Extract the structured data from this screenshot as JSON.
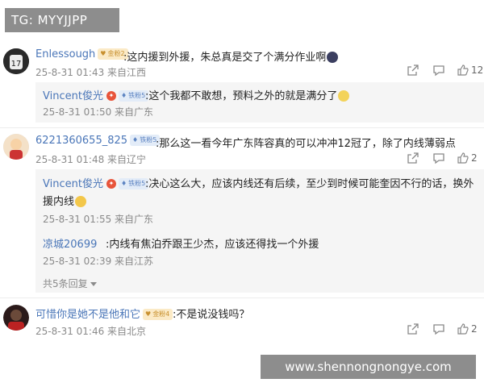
{
  "watermark_top": "TG: MYYJJPP",
  "watermark_bottom": "www.shennongnongye.com",
  "more_replies": "共5条回复",
  "comments": [
    {
      "user": "Enlessough",
      "badge": "金粉2",
      "text": ":这内援到外援，朱总真是交了个满分作业啊",
      "time": "25-8-31 01:43 来自江西",
      "likes": "12"
    },
    {
      "user": "6221360655_825",
      "badge": "铁粉5",
      "text": ":那么这一看今年广东阵容真的可以冲冲12冠了，除了内线薄弱点",
      "time": "25-8-31 01:48 来自辽宁",
      "likes": "2"
    },
    {
      "user": "可惜你是她不是他和它",
      "badge": "金粉4",
      "text": ":不是说没钱吗？",
      "time": "25-8-31 01:46 来自北京",
      "likes": "2"
    }
  ],
  "replies": [
    {
      "user": "Vincent俊光",
      "badge": "铁粉5",
      "text": ":这个我都不敢想，预料之外的就是满分了",
      "time": "25-8-31 01:50 来自广东"
    },
    {
      "user": "Vincent俊光",
      "badge": "铁粉5",
      "text_line1": ":决心这么大，应该内线还有后续，至少到时候可能奎因不行的话，换外",
      "text_line2": "援内线",
      "time": "25-8-31 01:55 来自广东"
    },
    {
      "user": "凉城20699",
      "text": ":内线有焦泊乔跟王少杰，应该还得找一个外援",
      "time": "25-8-31 02:39 来自江苏"
    }
  ]
}
